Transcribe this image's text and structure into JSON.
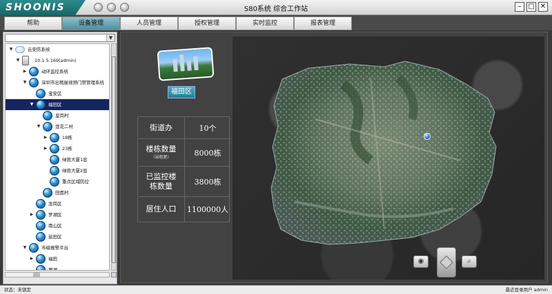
{
  "app": {
    "logo": "SHOONIS",
    "title": "S80系统 综合工作站"
  },
  "menu": {
    "tabs": [
      {
        "label": "帮助"
      },
      {
        "label": "设备管理",
        "active": true
      },
      {
        "label": "人员管理"
      },
      {
        "label": "授权管理"
      },
      {
        "label": "实时监控"
      },
      {
        "label": "报表管理"
      }
    ]
  },
  "tree": {
    "combo_value": "",
    "nodes": [
      {
        "label": "云安防系统",
        "level": 0,
        "toggle": "▼",
        "icon": "cloud-icon"
      },
      {
        "label": "10.1.5.169(admin)",
        "level": 1,
        "toggle": "▼",
        "icon": "device-icon"
      },
      {
        "label": "动环监控系统",
        "level": 2,
        "toggle": "▶",
        "icon": "globe-icon"
      },
      {
        "label": "深圳市出租屋视频门禁管理系统",
        "level": 2,
        "toggle": "▼",
        "icon": "globe-icon"
      },
      {
        "label": "宝安区",
        "level": 3,
        "toggle": "",
        "icon": "globe-icon"
      },
      {
        "label": "福田区",
        "level": 3,
        "toggle": "▼",
        "icon": "globe-icon",
        "selected": true
      },
      {
        "label": "皇岗村",
        "level": 4,
        "toggle": "",
        "icon": "globe-icon"
      },
      {
        "label": "莲花二村",
        "level": 4,
        "toggle": "▼",
        "icon": "globe-icon"
      },
      {
        "label": "18栋",
        "level": 5,
        "toggle": "▶",
        "icon": "globe-icon"
      },
      {
        "label": "23栋",
        "level": 5,
        "toggle": "▶",
        "icon": "globe-icon"
      },
      {
        "label": "绿茵大厦1层",
        "level": 5,
        "toggle": "",
        "icon": "globe-icon"
      },
      {
        "label": "绿茵大厦2层",
        "level": 5,
        "toggle": "",
        "icon": "globe-icon"
      },
      {
        "label": "重点区域防控",
        "level": 5,
        "toggle": "",
        "icon": "globe-icon"
      },
      {
        "label": "田面村",
        "level": 4,
        "toggle": "",
        "icon": "globe-icon"
      },
      {
        "label": "龙岗区",
        "level": 3,
        "toggle": "",
        "icon": "globe-icon"
      },
      {
        "label": "罗湖区",
        "level": 3,
        "toggle": "▶",
        "icon": "globe-icon"
      },
      {
        "label": "南山区",
        "level": 3,
        "toggle": "",
        "icon": "globe-icon"
      },
      {
        "label": "盐田区",
        "level": 3,
        "toggle": "",
        "icon": "globe-icon"
      },
      {
        "label": "市级报警平台",
        "level": 2,
        "toggle": "▼",
        "icon": "globe-icon"
      },
      {
        "label": "福田",
        "level": 3,
        "toggle": "▶",
        "icon": "globe-icon"
      },
      {
        "label": "罗湖",
        "level": 3,
        "toggle": "",
        "icon": "globe-icon"
      }
    ]
  },
  "district": {
    "name": "福田区",
    "stats": [
      {
        "key": "街道办",
        "sub": "",
        "value": "10个"
      },
      {
        "key": "楼栋数量",
        "sub": "（出租屋）",
        "value": "8000栋"
      },
      {
        "key": "已监控楼栋数量",
        "sub": "",
        "value": "3800栋"
      },
      {
        "key": "居住人口",
        "sub": "",
        "value": "1100000人"
      }
    ]
  },
  "map": {
    "tools": [
      "eye-icon",
      "pan-pad",
      "zoom-icon"
    ],
    "refresh_icon": "refresh-icon"
  },
  "status": {
    "left": "状态：未锁定",
    "right": "最近登录用户 admin"
  },
  "colors": {
    "accent": "#1f7f8f",
    "selection": "#15255e",
    "window_bg": "#3a3a3a"
  }
}
